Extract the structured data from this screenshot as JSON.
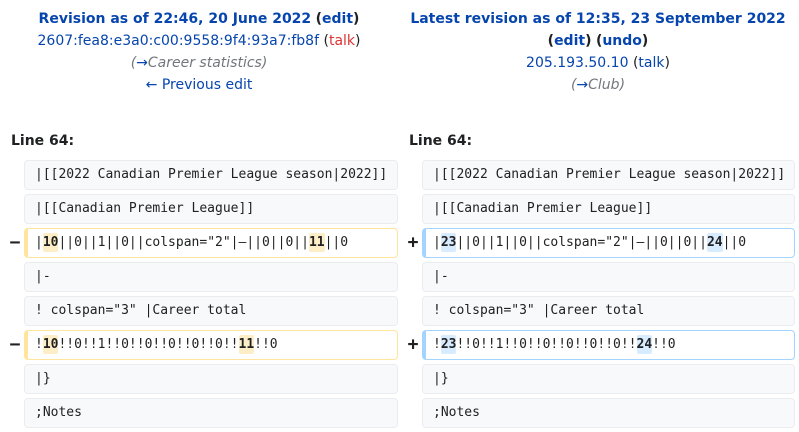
{
  "old": {
    "title": "Revision as of 22:46, 20 June 2022",
    "edit_label": "edit",
    "user": "2607:fea8:e3a0:c00:9558:9f4:93a7:fb8f",
    "talk_label": "talk",
    "summary_arrow": "→",
    "summary_section": "Career statistics",
    "prev_edit": "← Previous edit",
    "line_label": "Line 64:"
  },
  "new": {
    "title": "Latest revision as of 12:35, 23 September 2022",
    "edit_label": "edit",
    "undo_label": "undo",
    "user": "205.193.50.10",
    "talk_label": "talk",
    "summary_arrow": "→",
    "summary_section": "Club",
    "line_label": "Line 64:"
  },
  "markers": {
    "del": "−",
    "add": "+"
  },
  "lines": {
    "l1": "|[[2022 Canadian Premier League season|2022]]",
    "l2": "|[[Canadian Premier League]]",
    "l3_old_a": "|",
    "l3_old_b": "10",
    "l3_old_c": "||0||1||0||colspan=\"2\"|—||0||0||",
    "l3_old_d": "11",
    "l3_old_e": "||0",
    "l3_new_a": "|",
    "l3_new_b": "23",
    "l3_new_c": "||0||1||0||colspan=\"2\"|—||0||0||",
    "l3_new_d": "24",
    "l3_new_e": "||0",
    "l4": "|-",
    "l5": "! colspan=\"3\" |Career total",
    "l6_old_a": "!",
    "l6_old_b": "10",
    "l6_old_c": "!!0!!1!!0!!0!!0!!0!!0!!",
    "l6_old_d": "11",
    "l6_old_e": "!!0",
    "l6_new_a": "!",
    "l6_new_b": "23",
    "l6_new_c": "!!0!!1!!0!!0!!0!!0!!0!!",
    "l6_new_d": "24",
    "l6_new_e": "!!0",
    "l7": "|}",
    "l8": ";Notes"
  }
}
